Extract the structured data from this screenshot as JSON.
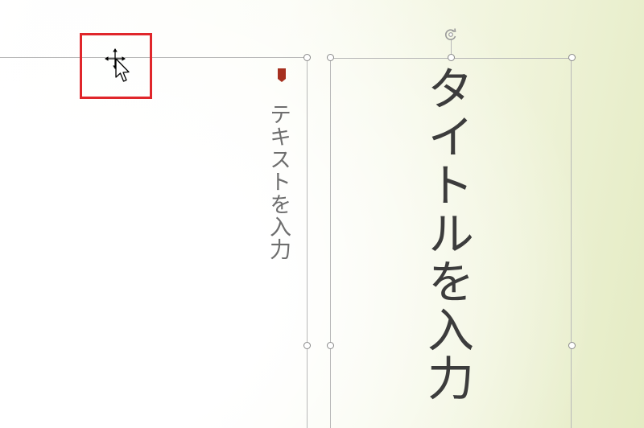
{
  "slide": {
    "title_placeholder": "タイトルを入力",
    "body_placeholder": "テキストを入力"
  },
  "colors": {
    "highlight": "#e0262b",
    "bullet": "#a6301f",
    "frame": "#b8b8b8"
  },
  "cursor": {
    "icon": "move-cursor-icon"
  }
}
